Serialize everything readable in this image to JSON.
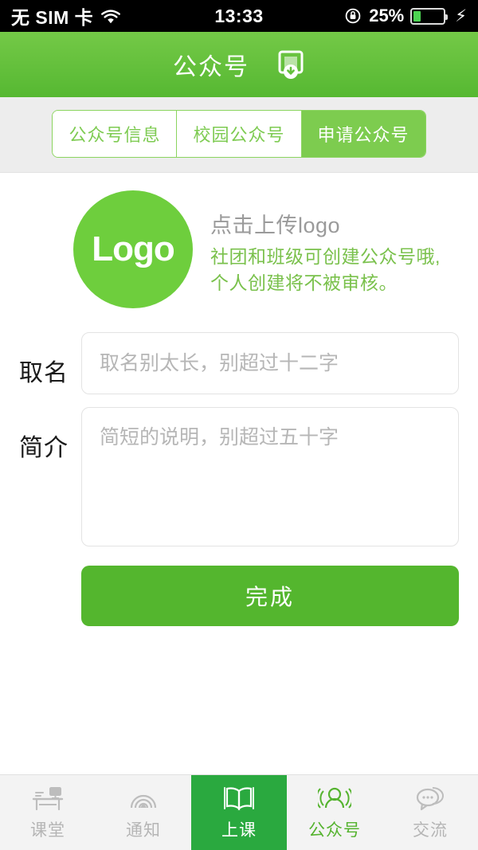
{
  "status_bar": {
    "carrier": "无 SIM 卡",
    "wifi_icon": "wifi-icon",
    "time": "13:33",
    "rotation_lock_icon": "rotation-lock-icon",
    "battery_percent": "25%",
    "battery_level": 25,
    "battery_fill_color": "#4cd452",
    "charging_icon": "lightning-bolt-icon"
  },
  "header": {
    "title": "公众号",
    "save_icon": "save-download-icon",
    "background_color": "#63c03c"
  },
  "segmented_tabs": {
    "items": [
      {
        "label": "公众号信息",
        "active": false
      },
      {
        "label": "校园公众号",
        "active": false
      },
      {
        "label": "申请公众号",
        "active": true
      }
    ],
    "accent_color": "#7dcc4f"
  },
  "form": {
    "logo": {
      "placeholder_text": "Logo",
      "circle_color": "#6ece3d",
      "upload_label": "点击上传logo",
      "note_line1": "社团和班级可创建公众号哦,",
      "note_line2": "个人创建将不被审核。",
      "note_color": "#7ac14c"
    },
    "name_field": {
      "label": "取名",
      "placeholder": "取名别太长，别超过十二字",
      "value": ""
    },
    "intro_field": {
      "label": "简介",
      "placeholder": "简短的说明，别超过五十字",
      "value": ""
    },
    "submit": {
      "label": "完成",
      "color": "#54b62e"
    }
  },
  "tabbar": {
    "items": [
      {
        "label": "课堂",
        "icon": "desk-icon",
        "state": "gray"
      },
      {
        "label": "通知",
        "icon": "broadcast-icon",
        "state": "gray"
      },
      {
        "label": "上课",
        "icon": "open-book-icon",
        "state": "active"
      },
      {
        "label": "公众号",
        "icon": "person-waves-icon",
        "state": "green"
      },
      {
        "label": "交流",
        "icon": "chat-bubble-icon",
        "state": "gray"
      }
    ],
    "active_background": "#2aa93f"
  }
}
